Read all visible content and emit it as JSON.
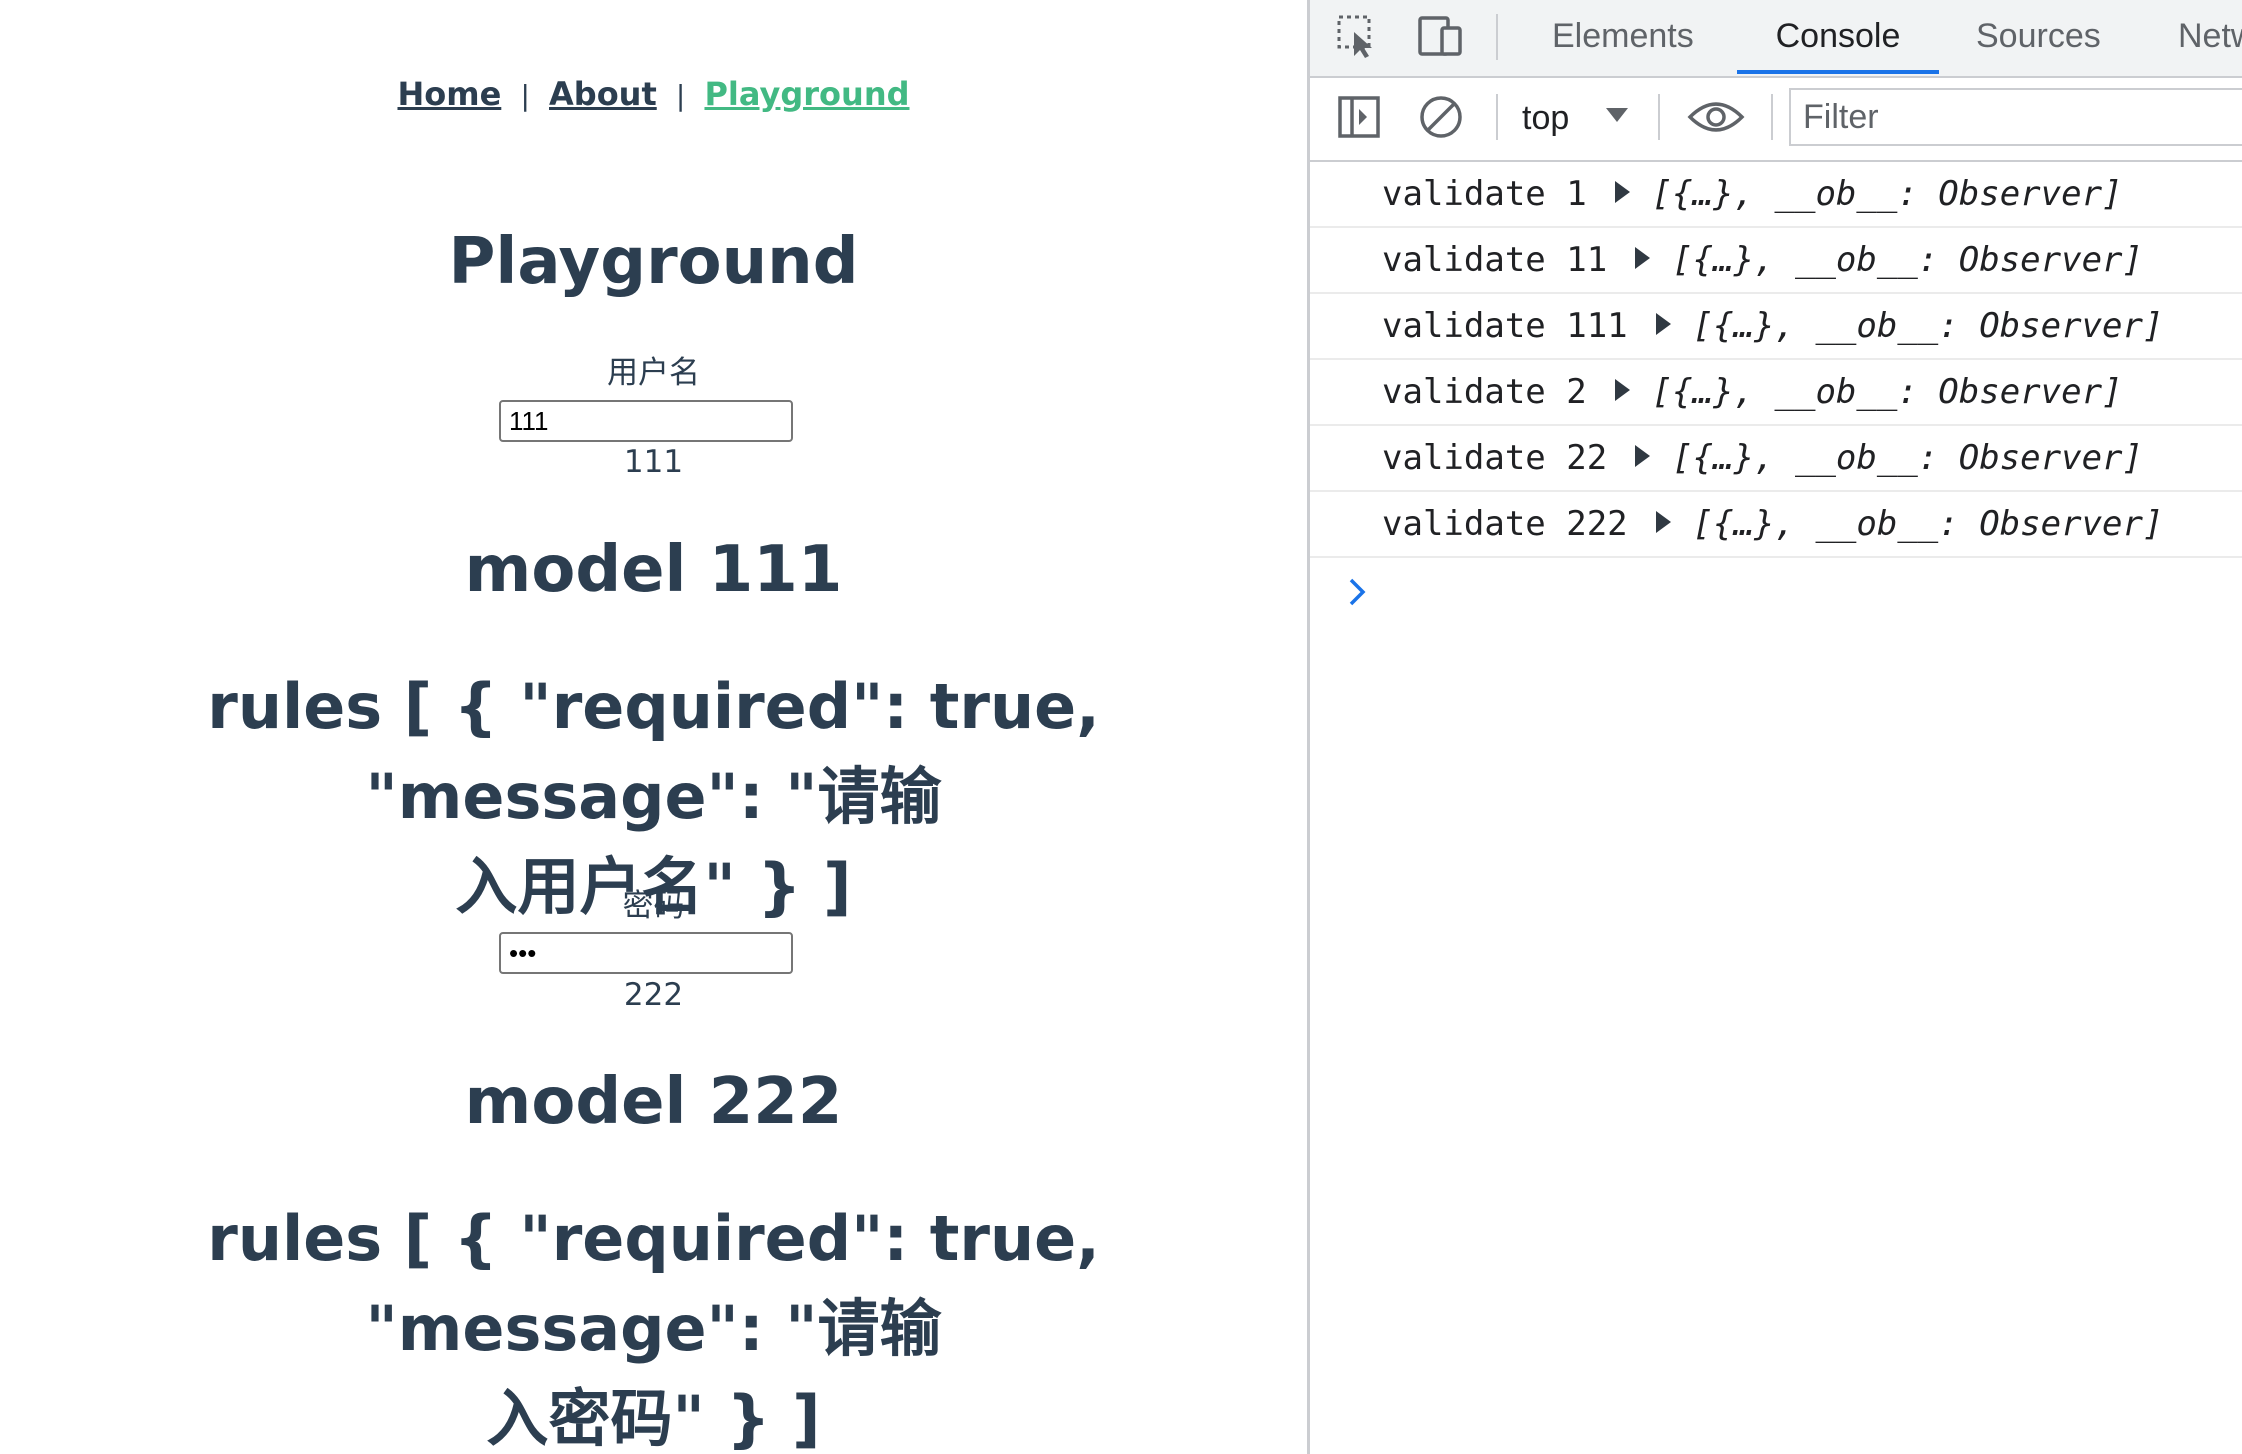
{
  "app": {
    "nav": {
      "links": [
        "Home",
        "About",
        "Playground"
      ],
      "separator": "|"
    },
    "title": "Playground",
    "fields": [
      {
        "label": "用户名",
        "input_value": "111",
        "echo": "111",
        "model": "model 111",
        "rules": "rules [ { \"required\": true, \"message\": \"请输\n入用户名\" } ]"
      },
      {
        "label": "密码",
        "input_value": "•••",
        "echo": "222",
        "model": "model 222",
        "rules": "rules [ { \"required\": true, \"message\": \"请输\n入密码\" } ]"
      }
    ]
  },
  "devtools": {
    "tabs": [
      "Elements",
      "Console",
      "Sources",
      "Netw"
    ],
    "active_tab": "Console",
    "toolbar": {
      "context": "top",
      "filter_placeholder": "Filter"
    },
    "console_logs": [
      {
        "text": "validate 1",
        "object": "[{…}, __ob__: Observer]"
      },
      {
        "text": "validate 11",
        "object": "[{…}, __ob__: Observer]"
      },
      {
        "text": "validate 111",
        "object": "[{…}, __ob__: Observer]"
      },
      {
        "text": "validate 2",
        "object": "[{…}, __ob__: Observer]"
      },
      {
        "text": "validate 22",
        "object": "[{…}, __ob__: Observer]"
      },
      {
        "text": "validate 222",
        "object": "[{…}, __ob__: Observer]"
      }
    ],
    "colors": {
      "accent": "#1a73e8",
      "link_active": "#42b983",
      "text": "#2c3e50"
    },
    "icons": [
      "inspect-element-icon",
      "device-toolbar-icon",
      "sidebar-toggle-icon",
      "clear-console-icon",
      "live-expression-eye-icon",
      "prompt-chevron-icon"
    ]
  }
}
